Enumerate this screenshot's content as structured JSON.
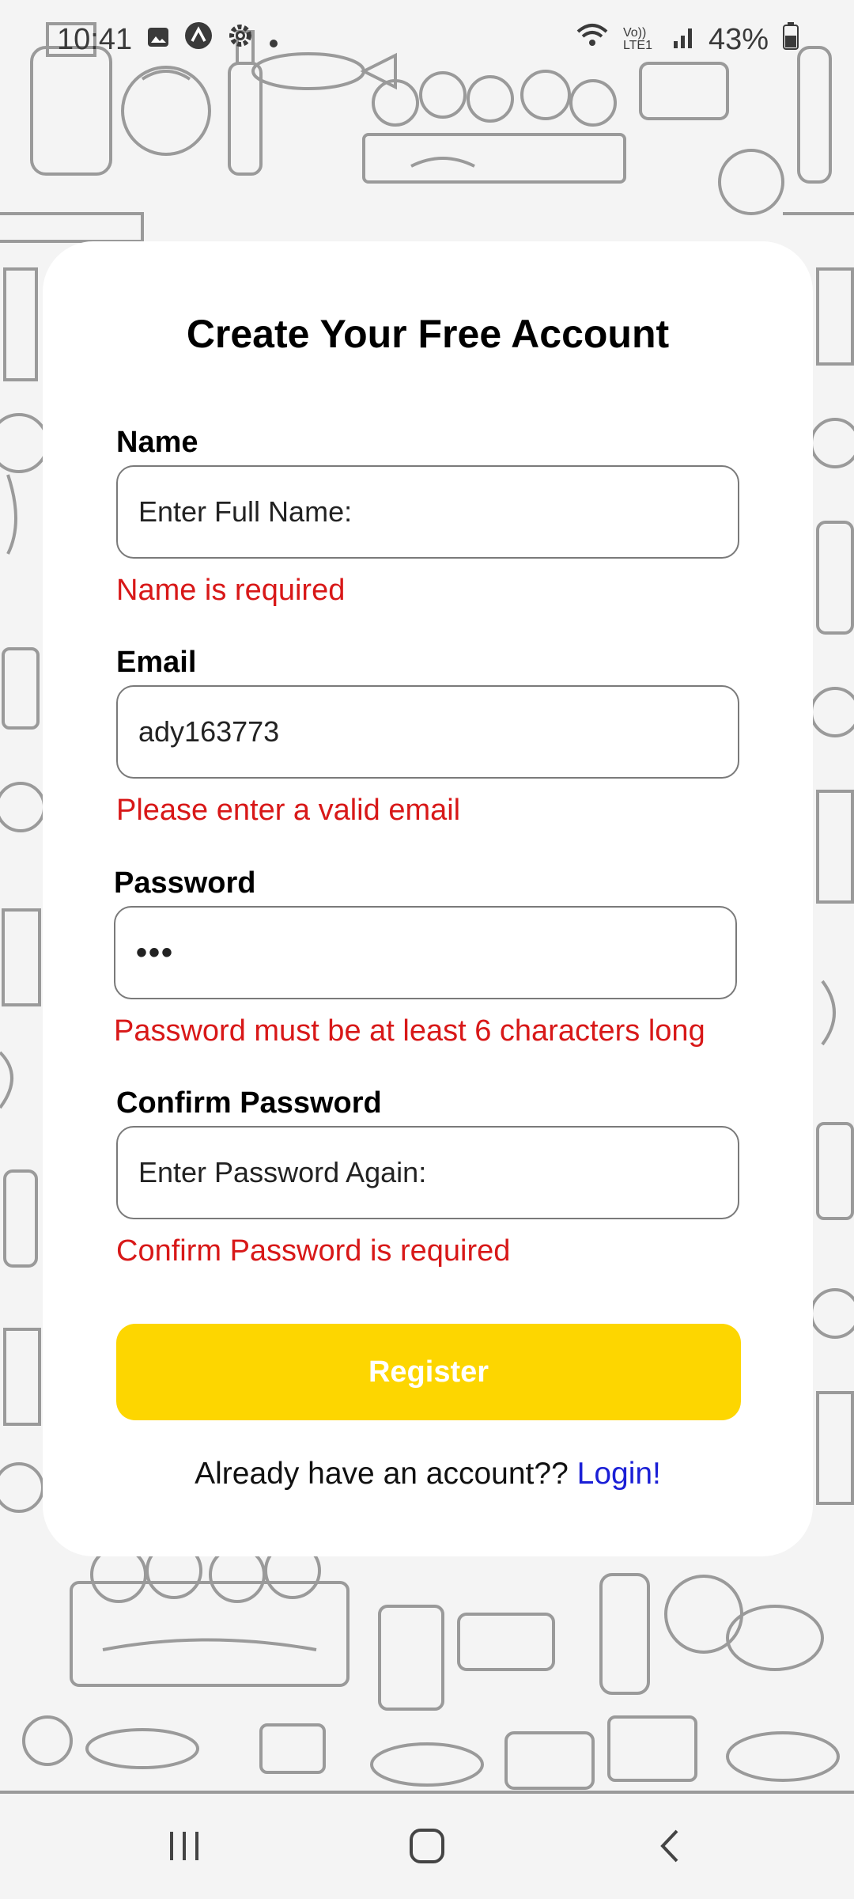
{
  "status_bar": {
    "time": "10:41",
    "battery": "43%",
    "network": "Vo)) LTE1"
  },
  "form": {
    "title": "Create Your Free Account",
    "name": {
      "label": "Name",
      "value": "",
      "placeholder": "Enter Full Name:",
      "error": "Name is required"
    },
    "email": {
      "label": "Email",
      "value": "ady163773",
      "placeholder": "",
      "error": "Please enter a valid email"
    },
    "password": {
      "label": "Password",
      "value": "•••",
      "error": "Password must be at least 6 characters long"
    },
    "confirm_password": {
      "label": "Confirm Password",
      "value": "",
      "placeholder": "Enter Password Again:",
      "error": "Confirm Password is required"
    },
    "register_label": "Register",
    "login_prompt": "Already have an account??",
    "login_link": "Login!"
  },
  "colors": {
    "accent": "#fdd600",
    "error": "#d81818",
    "link": "#1a1fd6"
  },
  "icons": [
    "image-icon",
    "app-icon",
    "gear-icon",
    "wifi-icon",
    "signal-icon",
    "battery-icon",
    "recents-icon",
    "home-icon",
    "back-icon"
  ]
}
